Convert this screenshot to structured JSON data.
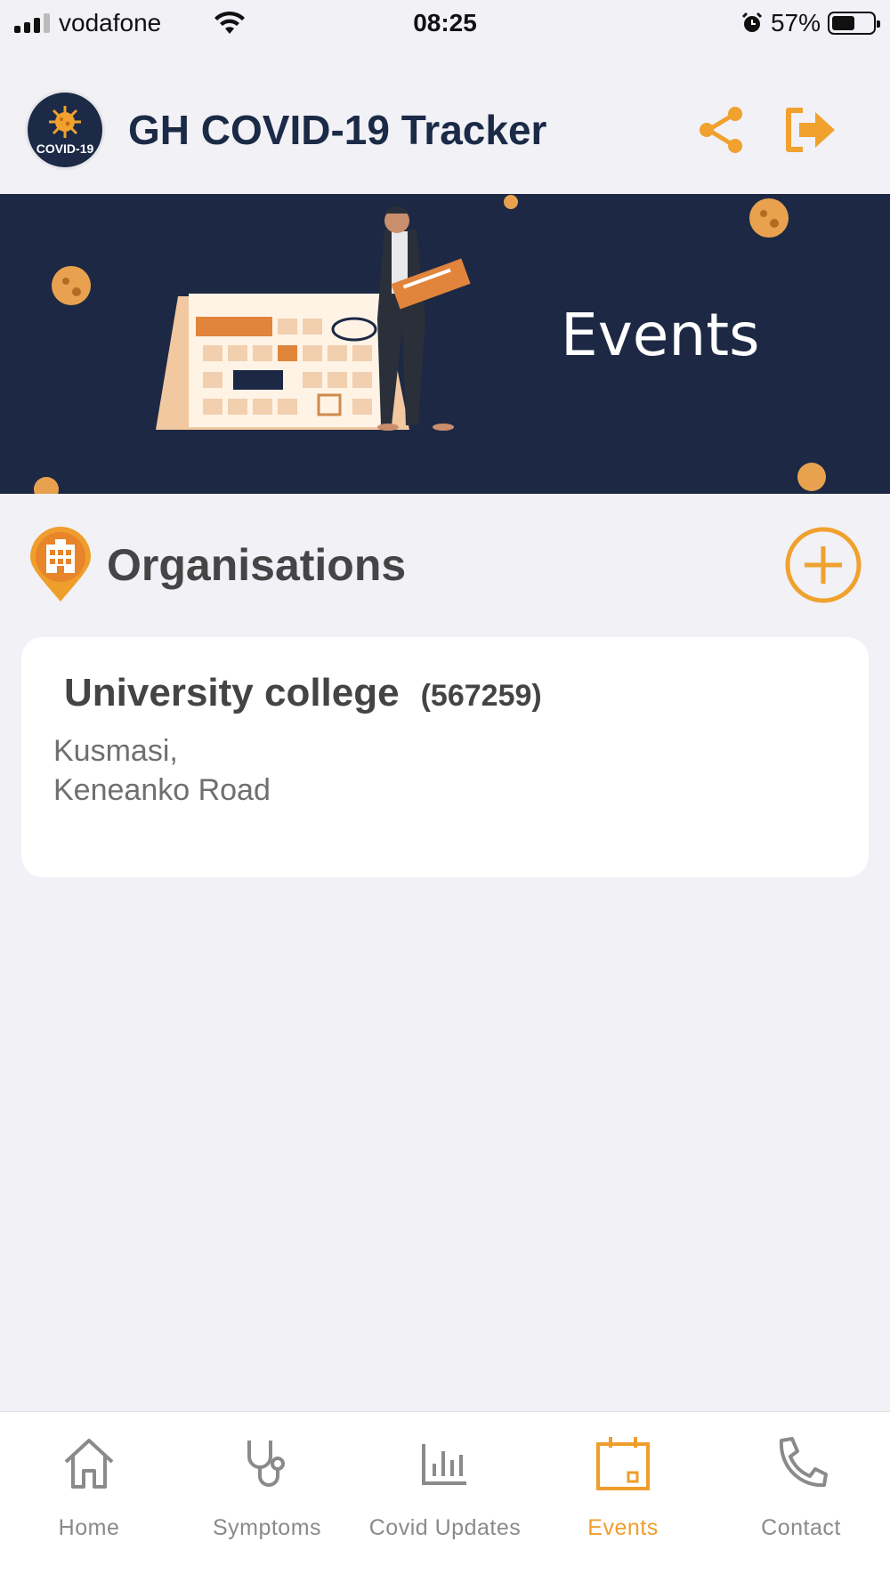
{
  "status_bar": {
    "carrier": "vodafone",
    "time": "08:25",
    "battery": "57%",
    "battery_level": 0.57
  },
  "header": {
    "logo_text": "COVID-19",
    "title": "GH COVID-19 Tracker",
    "share_icon": "share-icon",
    "logout_icon": "logout-icon",
    "accent_color": "#f0a12e"
  },
  "banner": {
    "title": "Events",
    "background_color": "#1d2944"
  },
  "section": {
    "title": "Organisations",
    "icon": "building-pin-icon",
    "add_icon": "plus-circle-icon"
  },
  "organisations": [
    {
      "name": "University college",
      "code": "(567259)",
      "address_line1": "Kusmasi,",
      "address_line2": "Keneanko Road"
    }
  ],
  "bottom_nav": {
    "items": [
      {
        "label": "Home",
        "icon": "home-icon"
      },
      {
        "label": "Symptoms",
        "icon": "stethoscope-icon"
      },
      {
        "label": "Covid Updates",
        "icon": "bar-chart-icon"
      },
      {
        "label": "Events",
        "icon": "calendar-icon",
        "active": true
      },
      {
        "label": "Contact",
        "icon": "phone-icon"
      }
    ],
    "active_color": "#ef9e2c",
    "inactive_color": "#8a8a8a"
  }
}
